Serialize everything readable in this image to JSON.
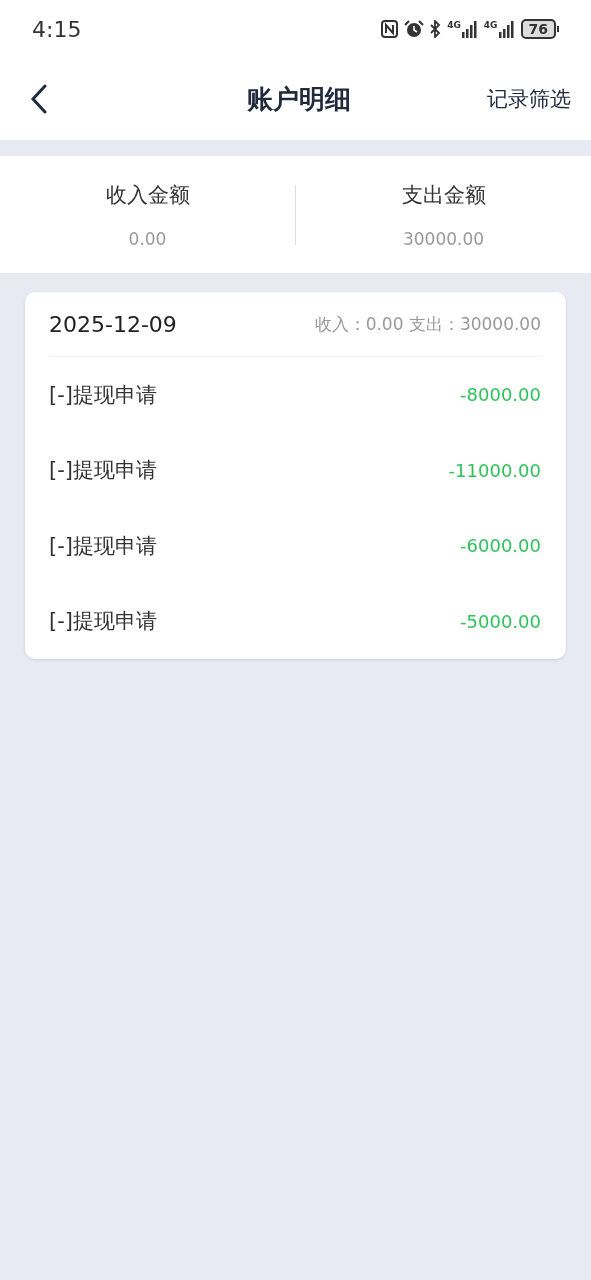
{
  "status_bar": {
    "time": "4:15",
    "networks": [
      {
        "label": "4G"
      },
      {
        "label": "4G"
      }
    ],
    "battery": "76"
  },
  "header": {
    "title": "账户明细",
    "action": "记录筛选"
  },
  "summary": [
    {
      "label": "收入金额",
      "value": "0.00"
    },
    {
      "label": "支出金额",
      "value": "30000.00"
    }
  ],
  "days": [
    {
      "date": "2025-12-09",
      "totals": "收入：0.00 支出：30000.00",
      "records": [
        {
          "title": "[-]提现申请",
          "amount": "-8000.00"
        },
        {
          "title": "[-]提现申请",
          "amount": "-11000.00"
        },
        {
          "title": "[-]提现申请",
          "amount": "-6000.00"
        },
        {
          "title": "[-]提现申请",
          "amount": "-5000.00"
        }
      ]
    }
  ]
}
